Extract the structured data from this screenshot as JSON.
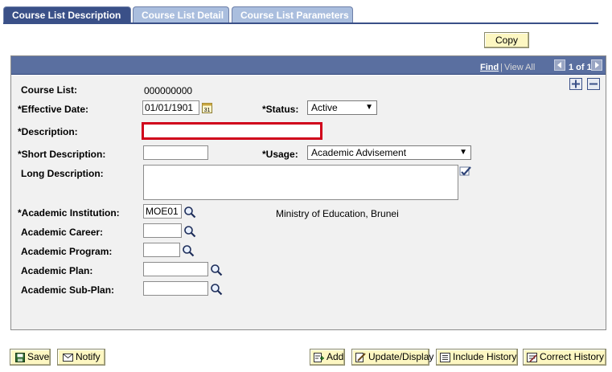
{
  "tabs": [
    {
      "label": "Course List Description",
      "active": true
    },
    {
      "label": "Course List Detail",
      "active": false
    },
    {
      "label": "Course List Parameters",
      "active": false
    }
  ],
  "copy_button": "Copy",
  "panel_header": {
    "find": "Find",
    "separator": "|",
    "view_all": "View All",
    "pager": "1 of 1"
  },
  "form": {
    "course_list": {
      "label": "Course List:",
      "value": "000000000"
    },
    "effective_date": {
      "label": "*Effective Date:",
      "value": "01/01/1901",
      "calendar_icon": "31"
    },
    "status": {
      "label": "*Status:",
      "value": "Active"
    },
    "description": {
      "label": "*Description:",
      "value": ""
    },
    "short_description": {
      "label": "*Short Description:",
      "value": ""
    },
    "usage": {
      "label": "*Usage:",
      "value": "Academic Advisement"
    },
    "long_description": {
      "label": "Long Description:",
      "value": ""
    },
    "academic_institution": {
      "label": "*Academic Institution:",
      "value": "MOE01",
      "description": "Ministry of Education, Brunei"
    },
    "academic_career": {
      "label": "Academic Career:",
      "value": ""
    },
    "academic_program": {
      "label": "Academic Program:",
      "value": ""
    },
    "academic_plan": {
      "label": "Academic Plan:",
      "value": ""
    },
    "academic_sub_plan": {
      "label": "Academic Sub-Plan:",
      "value": ""
    }
  },
  "toolbar": {
    "save": "Save",
    "notify": "Notify",
    "add": "Add",
    "update_display": "Update/Display",
    "include_history": "Include History",
    "correct_history": "Correct History"
  },
  "colors": {
    "tab_active": "#3a5088",
    "tab_inactive": "#aabede",
    "button_bg": "#fdf7c2",
    "panel_header": "#5a6fa0",
    "required_highlight": "#d0021b"
  }
}
